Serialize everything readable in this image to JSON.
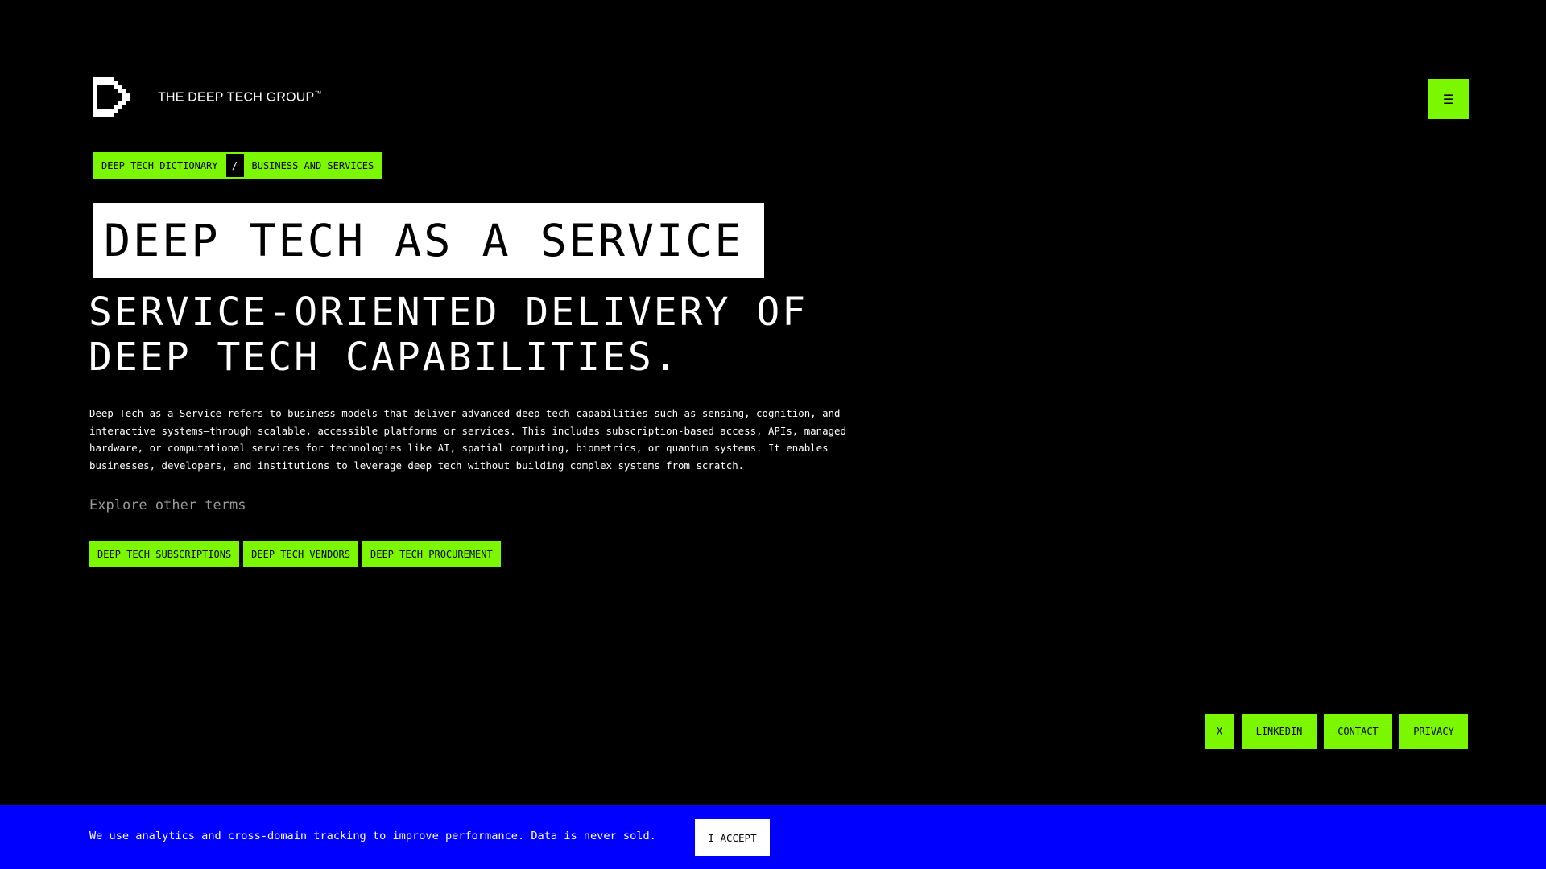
{
  "header": {
    "logo_icon": "pixel-chevron-logo-icon",
    "brand_name": "THE DEEP TECH GROUP",
    "brand_trademark": "™",
    "menu_icon": "☰"
  },
  "breadcrumb": {
    "items": [
      "DEEP TECH DICTIONARY",
      "BUSINESS AND SERVICES"
    ],
    "separator": "/"
  },
  "main": {
    "title": "DEEP TECH AS A SERVICE",
    "subtitle": "SERVICE-ORIENTED DELIVERY OF DEEP TECH CAPABILITIES.",
    "description": "Deep Tech as a Service refers to business models that deliver advanced deep tech capabilities—such as sensing, cognition, and interactive systems—through scalable, accessible platforms or services. This includes subscription-based access, APIs, managed hardware, or computational services for technologies like AI, spatial computing, biometrics, or quantum systems. It enables businesses, developers, and institutions to leverage deep tech without building complex systems from scratch.",
    "explore_label": "Explore other terms",
    "related_terms": [
      "DEEP TECH SUBSCRIPTIONS",
      "DEEP TECH VENDORS",
      "DEEP TECH PROCUREMENT"
    ]
  },
  "footer": {
    "links": [
      "X",
      "LINKEDIN",
      "CONTACT",
      "PRIVACY"
    ]
  },
  "cookie_banner": {
    "message": "We use analytics and cross-domain tracking to improve performance. Data is never sold.",
    "accept_label": "I ACCEPT"
  },
  "colors": {
    "background": "#000000",
    "accent_green": "#7bf800",
    "banner_blue": "#0000ff",
    "title_box": "#ffffff",
    "muted_text": "#9a9a9a"
  }
}
